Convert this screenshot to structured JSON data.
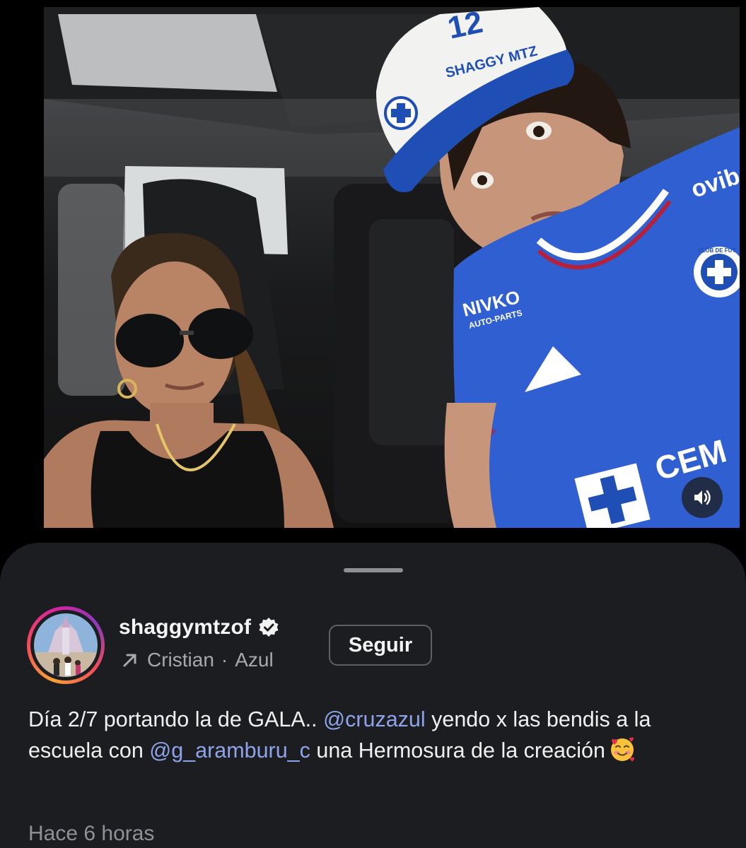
{
  "video": {
    "sound_icon": "speaker-volume-icon",
    "cap": {
      "number": "12",
      "name": "SHAGGY MTZ"
    },
    "jersey": {
      "sponsor_left": "NIVKO",
      "sponsor_left_sub": "AUTO-PARTS",
      "sponsor_right": "ovib",
      "front_text": "CEM",
      "crest_text": "CLUB DE FUT"
    }
  },
  "post": {
    "username": "shaggymtzof",
    "verified_icon": "verified-badge-icon",
    "audio_icon": "arrow-up-right-icon",
    "audio_name": "Cristian",
    "audio_separator": "·",
    "audio_artist": "Azul",
    "follow_label": "Seguir",
    "caption": {
      "part1": "Día 2/7 portando la de GALA.. ",
      "mention1": "@cruzazul",
      "part2": " yendo x las bendis a la escuela con ",
      "mention2": "@g_aramburu_c",
      "part3": " una Hermosura de la creación",
      "emoji_icon": "smiling-face-with-hearts-icon"
    },
    "timestamp": "Hace 6 horas"
  },
  "colors": {
    "sheet_bg": "#1c1d20",
    "mention": "#8fa4e8",
    "secondary_text": "#a8a9ad",
    "jersey_blue": "#2f5fd0",
    "cap_blue": "#1f4fb5"
  }
}
